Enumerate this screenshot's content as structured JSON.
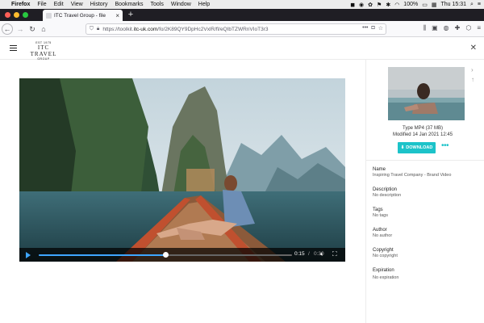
{
  "menubar": {
    "items": [
      "Firefox",
      "File",
      "Edit",
      "View",
      "History",
      "Bookmarks",
      "Tools",
      "Window",
      "Help"
    ],
    "battery": "100%",
    "clock": "Thu 15:31"
  },
  "tabs": [
    {
      "title": "ITC Travel Group - file"
    }
  ],
  "urlbar": {
    "prefix": "https://toolkit.",
    "host": "itc-uk.com",
    "path": "/fo/2K89QY9DpHc2VxlR/fl/eQIbTZWRnVIoT3r3"
  },
  "header": {
    "logo_top": "EST 1975",
    "logo_main": "ITC TRAVEL",
    "logo_sub": "GROUP"
  },
  "player": {
    "time_current": "0:15",
    "time_separator": "/",
    "time_total": "0:30",
    "progress": 0.5
  },
  "file": {
    "type_line": "Type MP4 (37 MB)",
    "modified_line": "Modified 14 Jan 2021 12:45",
    "download_label": "DOWNLOAD",
    "more_label": "•••",
    "fields": [
      {
        "label": "Name",
        "value": "Inspiring Travel Company - Brand Video"
      },
      {
        "label": "Description",
        "value": "No description"
      },
      {
        "label": "Tags",
        "value": "No tags"
      },
      {
        "label": "Author",
        "value": "No author"
      },
      {
        "label": "Copyright",
        "value": "No copyright"
      },
      {
        "label": "Expiration",
        "value": "No expiration"
      }
    ]
  },
  "colors": {
    "accent": "#1cc3c9",
    "progress": "#3ea6ff",
    "tabstrip": "#1f1e24"
  }
}
